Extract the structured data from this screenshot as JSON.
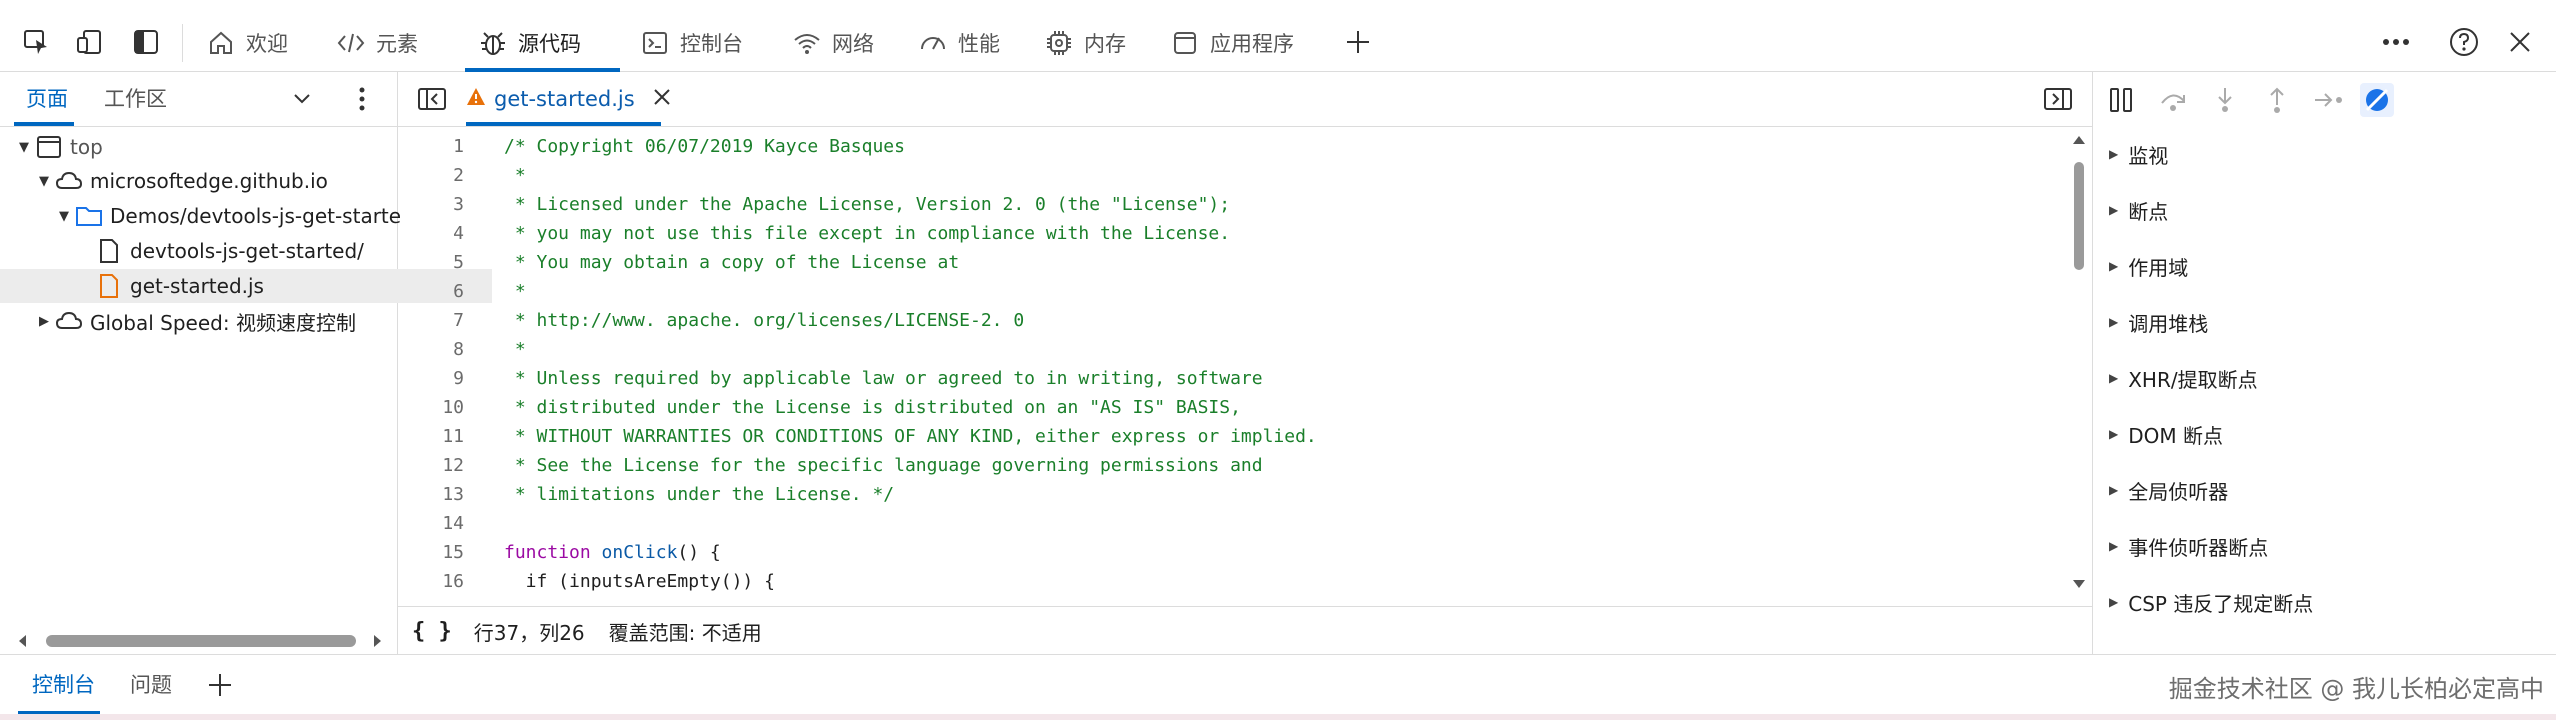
{
  "toolbar": {
    "tabs": [
      {
        "label": "欢迎",
        "icon": "home-icon"
      },
      {
        "label": "元素",
        "icon": "code-tags-icon"
      },
      {
        "label": "源代码",
        "icon": "bug-icon"
      },
      {
        "label": "控制台",
        "icon": "console-icon"
      },
      {
        "label": "网络",
        "icon": "wifi-icon"
      },
      {
        "label": "性能",
        "icon": "gauge-icon"
      },
      {
        "label": "内存",
        "icon": "chip-icon"
      },
      {
        "label": "应用程序",
        "icon": "app-window-icon"
      }
    ],
    "active_tab": "源代码",
    "accent_color": "#0067c0"
  },
  "navigator": {
    "tabs": [
      "页面",
      "工作区"
    ],
    "tree": [
      {
        "label": "top",
        "icon": "frame-icon"
      },
      {
        "label": "microsoftedge.github.io",
        "icon": "cloud-icon"
      },
      {
        "label": "Demos/devtools-js-get-starte",
        "icon": "folder-icon"
      },
      {
        "label": "devtools-js-get-started/",
        "icon": "file-icon"
      },
      {
        "label": "get-started.js",
        "icon": "js-file-icon"
      },
      {
        "label": "Global Speed: 视频速度控制",
        "icon": "cloud-icon"
      }
    ]
  },
  "editor": {
    "file_tab": "get-started.js",
    "lines": [
      {
        "n": "1",
        "text": "/* Copyright 06/07/2019 Kayce Basques"
      },
      {
        "n": "2",
        "text": " *"
      },
      {
        "n": "3",
        "text": " * Licensed under the Apache License, Version 2. 0 (the \"License\");"
      },
      {
        "n": "4",
        "text": " * you may not use this file except in compliance with the License."
      },
      {
        "n": "5",
        "text": " * You may obtain a copy of the License at"
      },
      {
        "n": "6",
        "text": " *"
      },
      {
        "n": "7",
        "text": " * http://www. apache. org/licenses/LICENSE-2. 0"
      },
      {
        "n": "8",
        "text": " *"
      },
      {
        "n": "9",
        "text": " * Unless required by applicable law or agreed to in writing, software"
      },
      {
        "n": "10",
        "text": " * distributed under the License is distributed on an \"AS IS\" BASIS,"
      },
      {
        "n": "11",
        "text": " * WITHOUT WARRANTIES OR CONDITIONS OF ANY KIND, either express or implied."
      },
      {
        "n": "12",
        "text": " * See the License for the specific language governing permissions and"
      },
      {
        "n": "13",
        "text": " * limitations under the License. */"
      },
      {
        "n": "14",
        "text": ""
      },
      {
        "n": "15",
        "kw": "function",
        "fn": "onClick",
        "rest": "() {"
      },
      {
        "n": "16",
        "text": "  if (inputsAreEmpty()) {"
      }
    ],
    "status": {
      "braces": "{ }",
      "position": "行37，列26",
      "coverage": "覆盖范围: 不适用"
    }
  },
  "debugger": {
    "sections": [
      "监视",
      "断点",
      "作用域",
      "调用堆栈",
      "XHR/提取断点",
      "DOM 断点",
      "全局侦听器",
      "事件侦听器断点",
      "CSP 违反了规定断点"
    ],
    "active_color": "#1a73e8"
  },
  "drawer": {
    "tabs": [
      "控制台",
      "问题"
    ],
    "watermark": "掘金技术社区 @ 我儿长柏必定高中"
  }
}
